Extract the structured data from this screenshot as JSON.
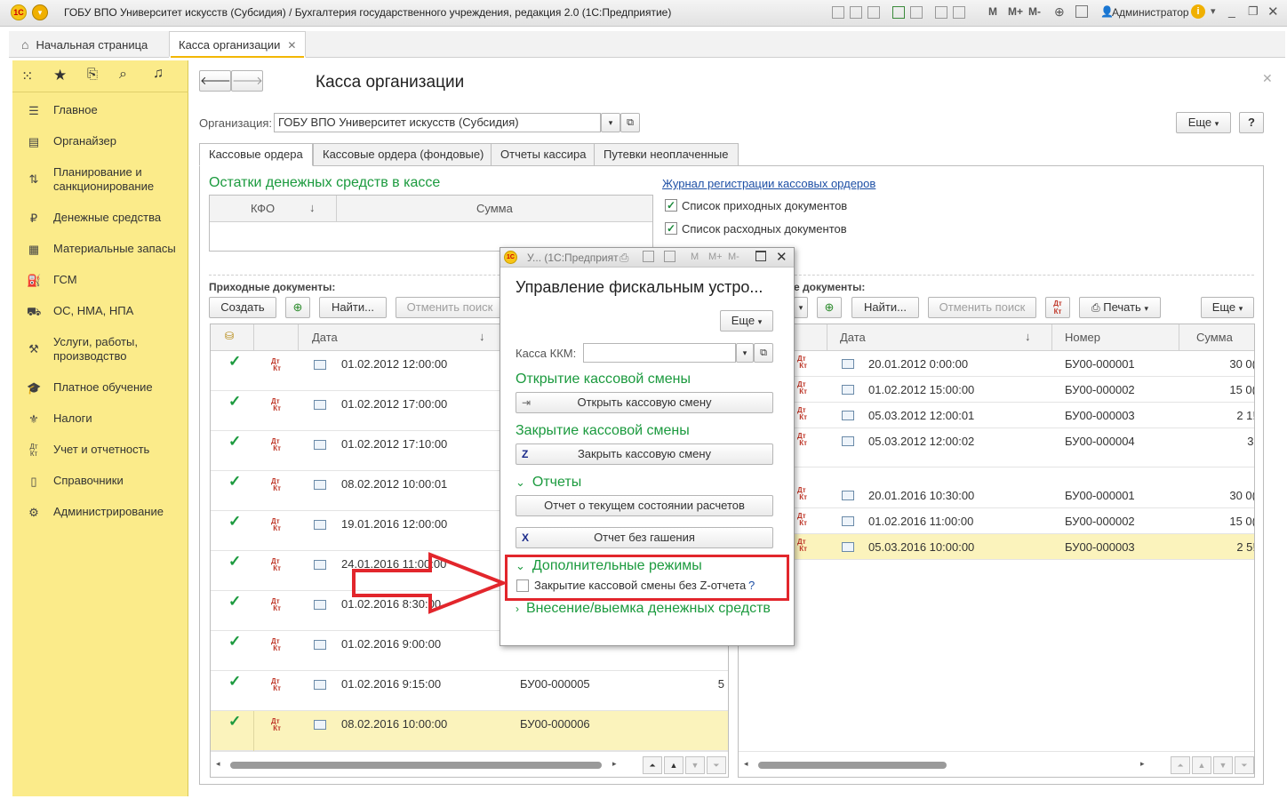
{
  "window": {
    "title": "ГОБУ ВПО Университет искусств (Субсидия) / Бухгалтерия государственного учреждения, редакция 2.0  (1С:Предприятие)",
    "logo": "1С",
    "user": "Администратор",
    "tb_m1": "M",
    "tb_m2": "M+",
    "tb_m3": "M-"
  },
  "tabs": {
    "home": "Начальная страница",
    "active": "Касса организации",
    "close_icon": "close-icon"
  },
  "sidebar": {
    "items": [
      {
        "label": "Главное",
        "icon": "menu-icon"
      },
      {
        "label": "Органайзер",
        "icon": "organizer-icon"
      },
      {
        "label": "Планирование и санкционирование",
        "icon": "planning-icon"
      },
      {
        "label": "Денежные средства",
        "icon": "money-icon"
      },
      {
        "label": "Материальные запасы",
        "icon": "inventory-icon"
      },
      {
        "label": "ГСМ",
        "icon": "fuel-icon"
      },
      {
        "label": "ОС, НМА, НПА",
        "icon": "truck-icon"
      },
      {
        "label": "Услуги, работы, производство",
        "icon": "tools-icon"
      },
      {
        "label": "Платное обучение",
        "icon": "education-icon"
      },
      {
        "label": "Налоги",
        "icon": "taxes-icon"
      },
      {
        "label": "Учет и отчетность",
        "icon": "dtkt-icon"
      },
      {
        "label": "Справочники",
        "icon": "catalog-icon"
      },
      {
        "label": "Администрирование",
        "icon": "gear-icon"
      }
    ]
  },
  "page": {
    "title": "Касса организации",
    "org_label": "Организация:",
    "org_value": "ГОБУ ВПО Университет искусств (Субсидия)",
    "more_label": "Еще",
    "help_label": "?",
    "tabs": [
      "Кассовые ордера",
      "Кассовые ордера (фондовые)",
      "Отчеты кассира",
      "Путевки неоплаченные"
    ],
    "balance_title": "Остатки денежных средств в кассе",
    "balance_cols": [
      "КФО",
      "Сумма"
    ],
    "journal_link": "Журнал регистрации кассовых ордеров",
    "check_income": "Список приходных документов",
    "check_expense": "Список расходных документов"
  },
  "income": {
    "header": "Приходные документы:",
    "create": "Создать",
    "find": "Найти...",
    "cancel_search": "Отменить поиск",
    "col_date": "Дата",
    "rows": [
      {
        "date": "01.02.2012 12:00:00",
        "number": "",
        "sum": ""
      },
      {
        "date": "01.02.2012 17:00:00",
        "number": "",
        "sum": ""
      },
      {
        "date": "01.02.2012 17:10:00",
        "number": "",
        "sum": ""
      },
      {
        "date": "08.02.2012 10:00:01",
        "number": "",
        "sum": ""
      },
      {
        "date": "19.01.2016 12:00:00",
        "number": "",
        "sum": ""
      },
      {
        "date": "24.01.2016 11:00:00",
        "number": "",
        "sum": ""
      },
      {
        "date": "01.02.2016 8:30:00",
        "number": "",
        "sum": ""
      },
      {
        "date": "01.02.2016 9:00:00",
        "number": "",
        "sum": ""
      },
      {
        "date": "01.02.2016 9:15:00",
        "number": "БУ00-000005",
        "sum": "5"
      },
      {
        "date": "08.02.2016 10:00:00",
        "number": "БУ00-000006",
        "sum": ""
      }
    ]
  },
  "expense": {
    "header": "е документы:",
    "find": "Найти...",
    "cancel_search": "Отменить поиск",
    "print": "Печать",
    "more": "Еще",
    "col_date": "Дата",
    "col_number": "Номер",
    "col_sum": "Сумма",
    "rows": [
      {
        "date": "20.01.2012 0:00:00",
        "number": "БУ00-000001",
        "sum": "30 0("
      },
      {
        "date": "01.02.2012 15:00:00",
        "number": "БУ00-000002",
        "sum": "15 0("
      },
      {
        "date": "05.03.2012 12:00:01",
        "number": "БУ00-000003",
        "sum": "2 1!"
      },
      {
        "date": "05.03.2012 12:00:02",
        "number": "БУ00-000004",
        "sum": "3'"
      },
      {
        "date": "20.01.2016 10:30:00",
        "number": "БУ00-000001",
        "sum": "30 0("
      },
      {
        "date": "01.02.2016 11:00:00",
        "number": "БУ00-000002",
        "sum": "15 0("
      },
      {
        "date": "05.03.2016 10:00:00",
        "number": "БУ00-000003",
        "sum": "2 5!"
      }
    ]
  },
  "dialog": {
    "window_title": "У...  (1С:Предприят",
    "tb_m1": "M",
    "tb_m2": "M+",
    "tb_m3": "M-",
    "title": "Управление фискальным устро...",
    "more": "Еще",
    "kkm_label": "Касса ККМ:",
    "kkm_value": "",
    "open_section": "Открытие кассовой смены",
    "open_button": "Открыть кассовую смену",
    "close_section": "Закрытие кассовой смены",
    "close_button": "Закрыть кассовую смену",
    "reports_section": "Отчеты",
    "report_state": "Отчет о текущем состоянии расчетов",
    "report_x": "Отчет без гашения",
    "extra_section": "Дополнительные режимы",
    "extra_check": "Закрытие кассовой смены без Z-отчета",
    "extra_help": "?",
    "cash_section": "Внесение/выемка денежных средств"
  },
  "colors": {
    "sidebar": "#fbeb8a",
    "green_heading": "#1b9a3e",
    "selected_row": "#fbf3bc",
    "annotation_red": "#e2262c"
  }
}
